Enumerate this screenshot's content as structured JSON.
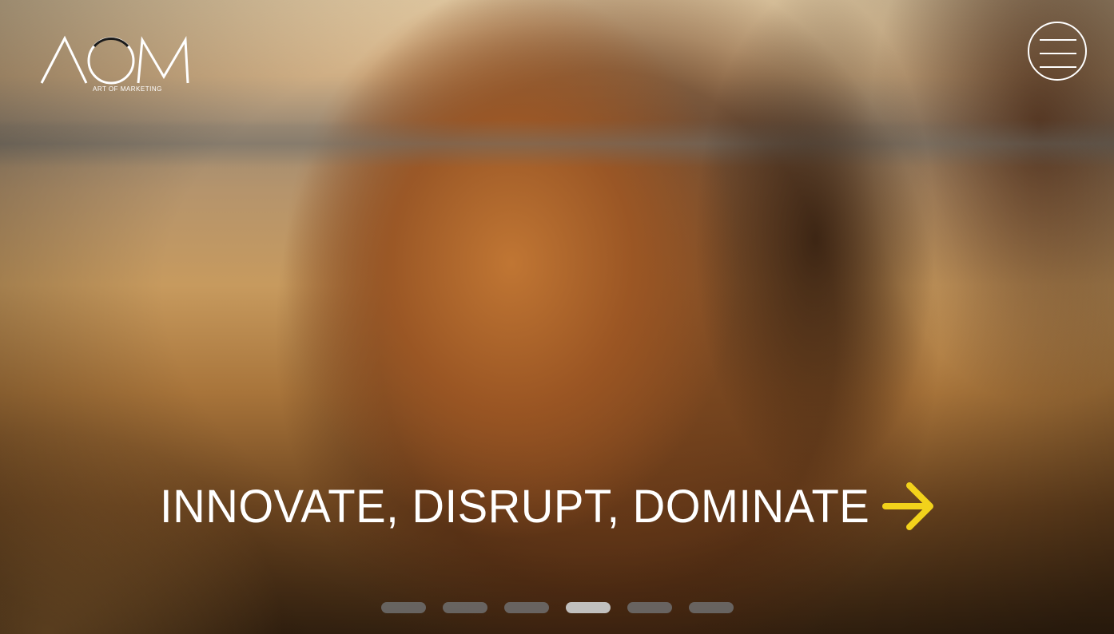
{
  "brand": {
    "logo_text": "AOM",
    "tagline": "ART OF MARKETING"
  },
  "menu": {
    "icon": "hamburger-menu-icon"
  },
  "hero": {
    "background_subject": "lion-in-savanna-photo",
    "headline": "INNOVATE, DISRUPT, DOMINATE",
    "arrow_icon": "arrow-right-icon",
    "arrow_color": "#f2d21b"
  },
  "pagination": {
    "count": 6,
    "active_index": 3
  },
  "colors": {
    "text": "#ffffff",
    "accent": "#f2d21b",
    "dot_inactive": "#6e6e6e",
    "dot_active": "#c8c8c8"
  }
}
